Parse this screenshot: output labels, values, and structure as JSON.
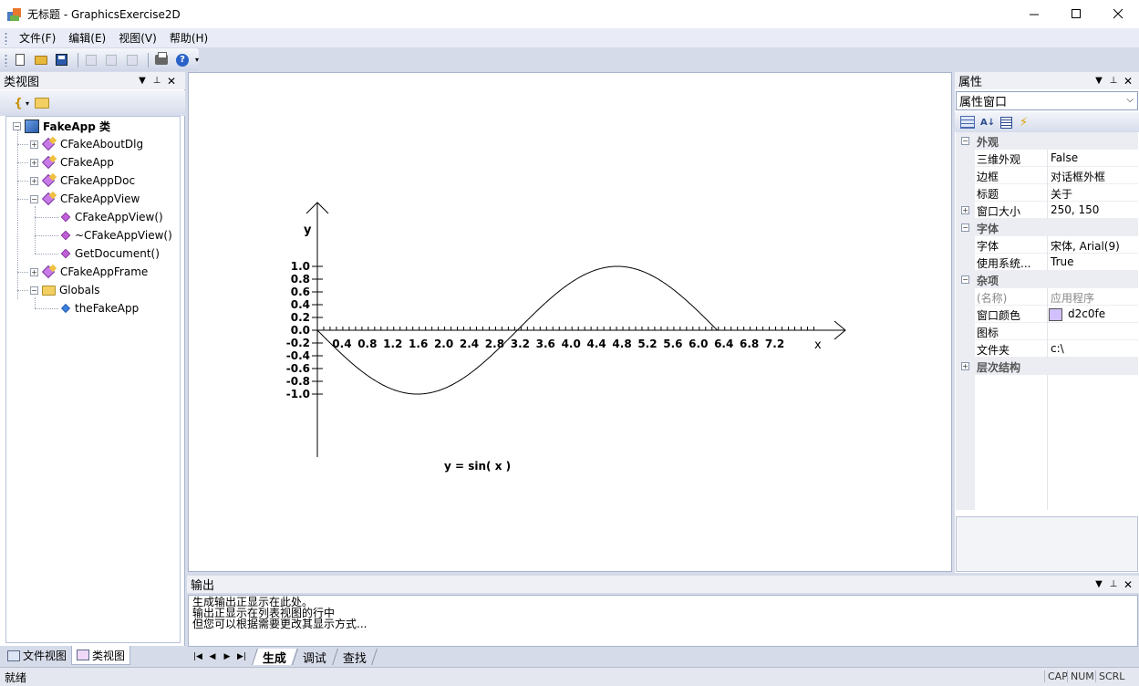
{
  "window": {
    "title": "无标题 - GraphicsExercise2D",
    "minimize_icon": "minimize-icon",
    "maximize_icon": "maximize-icon",
    "close_icon": "close-icon"
  },
  "menu": [
    {
      "label": "文件(F)"
    },
    {
      "label": "编辑(E)"
    },
    {
      "label": "视图(V)"
    },
    {
      "label": "帮助(H)"
    }
  ],
  "toolbar": {
    "icons": [
      "new-document-icon",
      "open-folder-icon",
      "save-icon",
      "cut-icon",
      "copy-icon",
      "paste-icon",
      "print-icon",
      "help-icon"
    ],
    "help_glyph": "?"
  },
  "classview": {
    "title": "类视图",
    "tree": {
      "root": "FakeApp 类",
      "items": [
        {
          "label": "CFakeAboutDlg"
        },
        {
          "label": "CFakeApp"
        },
        {
          "label": "CFakeAppDoc"
        },
        {
          "label": "CFakeAppView"
        },
        {
          "label": "CFakeAppView()"
        },
        {
          "label": "~CFakeAppView()"
        },
        {
          "label": "GetDocument()"
        },
        {
          "label": "CFakeAppFrame"
        },
        {
          "label": "Globals"
        },
        {
          "label": "theFakeApp"
        }
      ]
    }
  },
  "left_tabs": [
    {
      "label": "文件视图"
    },
    {
      "label": "类视图"
    }
  ],
  "chart_data": {
    "type": "line",
    "function": "sin",
    "title": "y = sin( x )",
    "xlabel": "x",
    "ylabel": "y",
    "x_ticks": [
      "0.4",
      "0.8",
      "1.2",
      "1.6",
      "2.0",
      "2.4",
      "2.8",
      "3.2",
      "3.6",
      "4.0",
      "4.4",
      "4.8",
      "5.2",
      "5.6",
      "6.0",
      "6.4",
      "6.8",
      "7.2"
    ],
    "y_ticks": [
      "1.0",
      "0.8",
      "0.6",
      "0.4",
      "0.2",
      "0.0",
      "-0.2",
      "-0.4",
      "-0.6",
      "-0.8",
      "-1.0"
    ],
    "xlim": [
      0,
      7.2
    ],
    "ylim": [
      -1.0,
      1.0
    ],
    "series": [
      {
        "x_range": [
          0,
          6.2832
        ],
        "y_sign": -1
      }
    ],
    "grid": false
  },
  "properties": {
    "title": "属性",
    "combo": "属性窗口",
    "categories": [
      {
        "name": "外观",
        "rows": [
          {
            "name": "三维外观",
            "value": "False"
          },
          {
            "name": "边框",
            "value": "对话框外框"
          },
          {
            "name": "标题",
            "value": "关于"
          },
          {
            "name": "窗口大小",
            "value": "250, 150"
          }
        ]
      },
      {
        "name": "字体",
        "rows": [
          {
            "name": "字体",
            "value": "宋体, Arial(9)"
          },
          {
            "name": "使用系统...",
            "value": "True"
          }
        ]
      },
      {
        "name": "杂项",
        "rows": [
          {
            "name": "(名称)",
            "value": "应用程序"
          },
          {
            "name": "窗口颜色",
            "value": "d2c0fe"
          },
          {
            "name": "图标",
            "value": ""
          },
          {
            "name": "文件夹",
            "value": "c:\\"
          }
        ]
      },
      {
        "name": "层次结构",
        "rows": []
      }
    ],
    "swatch_color": "#d2c0fe"
  },
  "output": {
    "title": "输出",
    "lines": [
      "生成输出正显示在此处。",
      "输出正显示在列表视图的行中",
      "但您可以根据需要更改其显示方式..."
    ],
    "tabs": [
      {
        "label": "生成"
      },
      {
        "label": "调试"
      },
      {
        "label": "查找"
      }
    ]
  },
  "status": {
    "text": "就绪",
    "indicators": [
      "CAP",
      "NUM",
      "SCRL"
    ]
  }
}
